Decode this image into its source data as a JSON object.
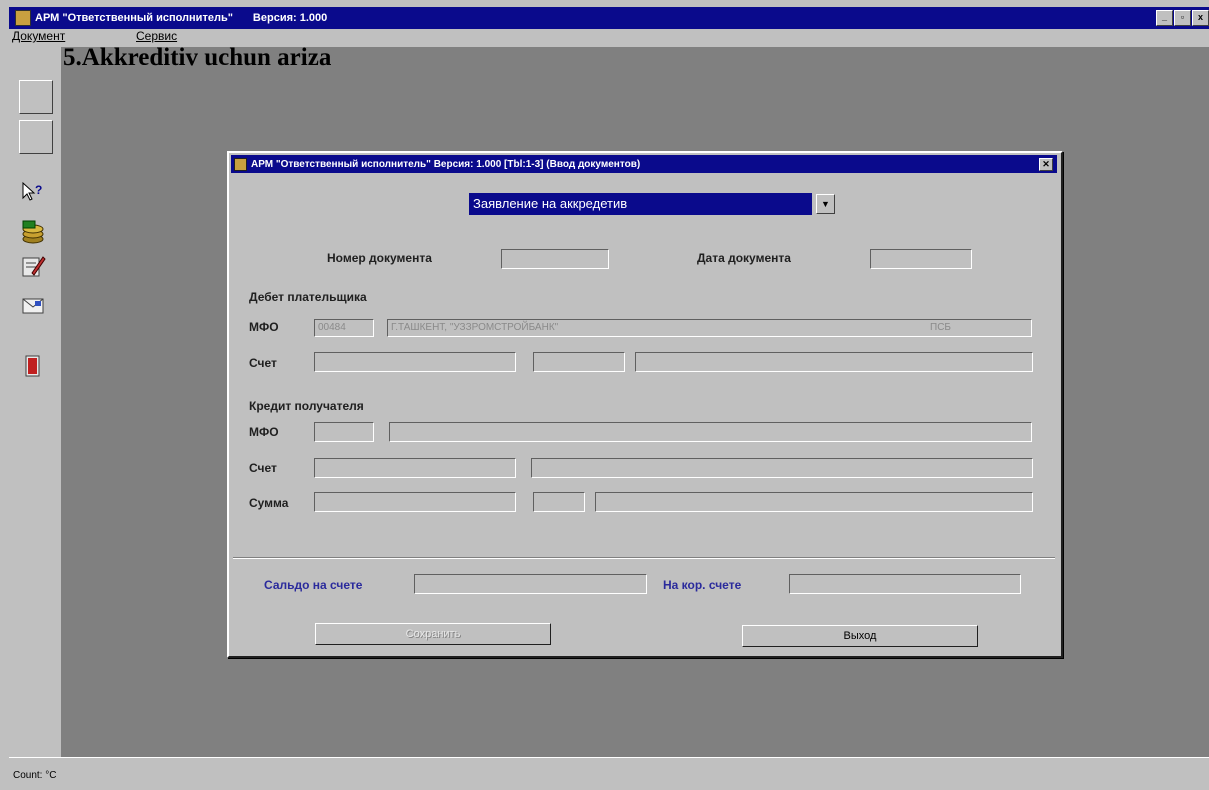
{
  "app": {
    "title": "АРМ \"Ответственный исполнитель\"",
    "version": "Версия: 1.000",
    "window_buttons": [
      "_",
      "▫",
      "x"
    ]
  },
  "menu": {
    "document": "Документ",
    "service": "Сервис"
  },
  "overlay_title": "5.Akkreditiv uchun ariza",
  "toolbar_icons": [
    "help-cursor-icon",
    "coins-icon",
    "edit-document-icon",
    "envelope-icon",
    "exit-door-icon"
  ],
  "status": {
    "text": "Count: °C"
  },
  "dialog": {
    "title": "АРМ \"Ответственный исполнитель\" Версия: 1.000 [Tbl:1-3] (Ввод документов)",
    "close": "✕",
    "doc_type": "Заявление на аккредетив",
    "doc_number_label": "Номер документа",
    "doc_date_label": "Дата документа",
    "debit_section": "Дебет плательщика",
    "mfo_label": "МФО",
    "debit_mfo": "00484",
    "debit_bank": "Г.ТАШКЕНТ, \"УЗЗРОМСТРОЙБАНК\"",
    "debit_bank_code": "ПСБ",
    "account_label": "Счет",
    "credit_section": "Кредит получателя",
    "sum_label": "Сумма",
    "balance_label": "Сальдо на счете",
    "corr_label": "На кор. счете",
    "save_button": "Сохранить",
    "exit_button": "Выход"
  }
}
